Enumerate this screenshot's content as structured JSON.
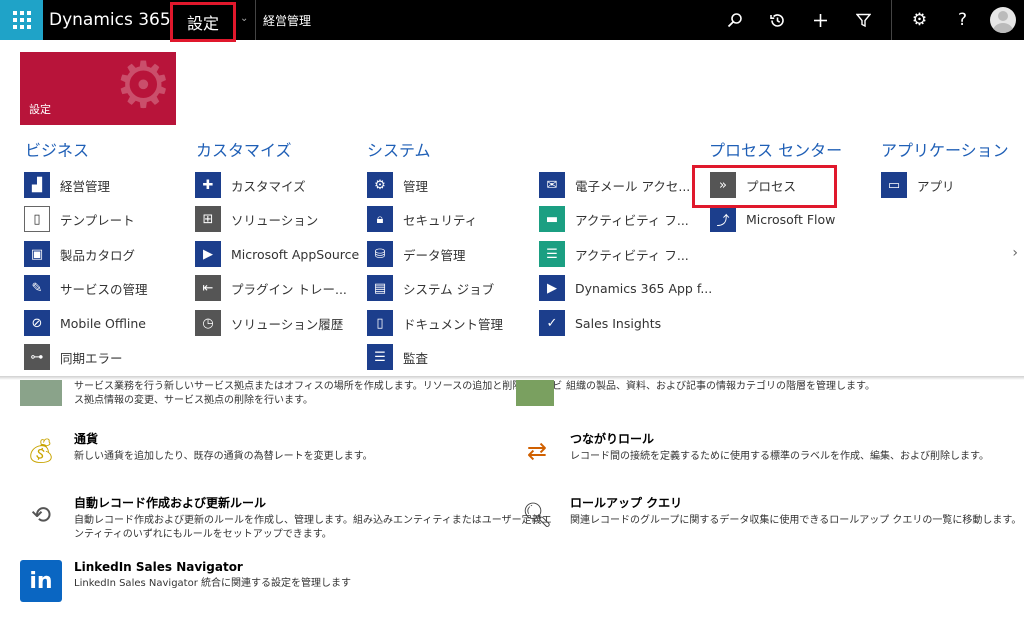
{
  "topbar": {
    "brand": "Dynamics 365",
    "area": "設定",
    "sub_area": "経営管理",
    "icons": [
      "search-icon",
      "history-icon",
      "plus-icon",
      "filter-icon",
      "gear-icon",
      "help-icon",
      "avatar"
    ]
  },
  "tile": {
    "label": "設定"
  },
  "menu": {
    "columns": [
      {
        "heading": "ビジネス",
        "items": [
          "経営管理",
          "テンプレート",
          "製品カタログ",
          "サービスの管理",
          "Mobile Offline",
          "同期エラー"
        ]
      },
      {
        "heading": "カスタマイズ",
        "items": [
          "カスタマイズ",
          "ソリューション",
          "Microsoft AppSource",
          "プラグイン トレー...",
          "ソリューション履歴"
        ]
      },
      {
        "heading": "システム",
        "items": [
          "管理",
          "セキュリティ",
          "データ管理",
          "システム ジョブ",
          "ドキュメント管理",
          "監査"
        ]
      },
      {
        "heading": "",
        "items": [
          "電子メール アクセ...",
          "アクティビティ フ...",
          "アクティビティ フ...",
          "Dynamics 365 App f...",
          "Sales Insights"
        ]
      },
      {
        "heading": "プロセス センター",
        "items": [
          "プロセス",
          "Microsoft Flow"
        ]
      },
      {
        "heading": "アプリケーション",
        "items": [
          "アプリ"
        ]
      }
    ]
  },
  "entries": {
    "service": {
      "desc1": "サービス業務を行う新しいサービス拠点またはオフィスの場所を作成します。リソースの追加と削除、サービ",
      "desc2": "ス拠点情報の変更、サービス拠点の削除を行います。"
    },
    "catalog": {
      "desc1": "組織の製品、資料、および記事の情報カテゴリの階層を管理します。"
    },
    "currency": {
      "title": "通貨",
      "desc1": "新しい通貨を追加したり、既存の通貨の為替レートを変更します。"
    },
    "roles": {
      "title": "つながりロール",
      "desc1": "レコード間の接続を定義するために使用する標準のラベルを作成、編集、および削除します。"
    },
    "auto": {
      "title": "自動レコード作成および更新ルール",
      "desc1": "自動レコード作成および更新のルールを作成し、管理します。組み込みエンティティまたはユーザー定義エ",
      "desc2": "ンティティのいずれにもルールをセットアップできます。"
    },
    "rollup": {
      "title": "ロールアップ クエリ",
      "desc1": "関連レコードのグループに関するデータ収集に使用できるロールアップ クエリの一覧に移動します。"
    },
    "linkedin": {
      "title": "LinkedIn Sales Navigator",
      "desc1": "LinkedIn Sales Navigator 統合に関連する設定を管理します"
    }
  }
}
